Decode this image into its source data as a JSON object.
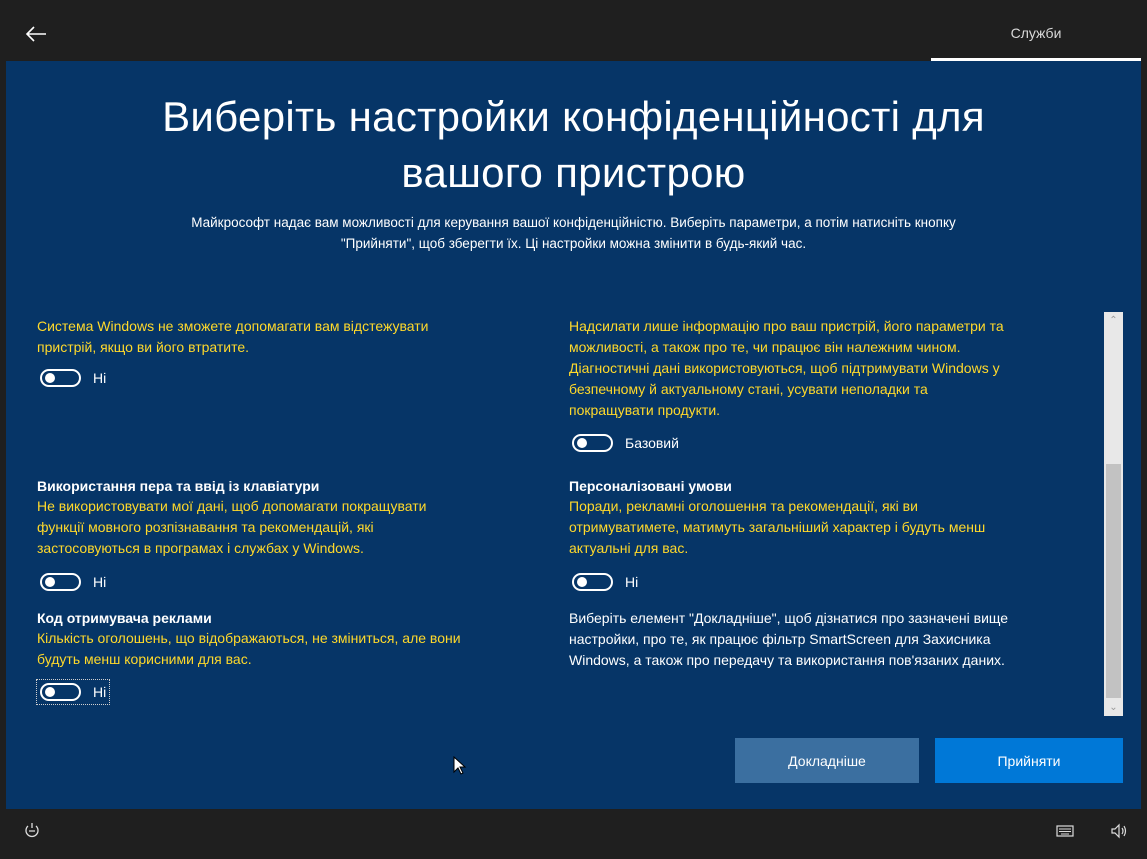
{
  "topbar": {
    "tab_label": "Служби"
  },
  "page": {
    "title_line1": "Виберіть настройки конфіденційності для",
    "title_line2": "вашого пристрою",
    "subtitle_line1": "Майкрософт надає вам можливості для керування вашої конфіденційністю. Виберіть параметри, а потім натисніть кнопку",
    "subtitle_line2": "\"Прийняти\", щоб зберегти їх. Ці настройки можна змінити в будь-який час."
  },
  "settings": {
    "find_device": {
      "desc_line1": "Система Windows не зможете допомагати вам відстежувати",
      "desc_line2": "пристрій, якщо ви його втратите.",
      "toggle_label": "Ні"
    },
    "inking": {
      "heading": "Використання пера та ввід із клавіатури",
      "desc_line1": "Не використовувати мої дані, щоб допомагати покращувати",
      "desc_line2": "функції мовного розпізнавання та рекомендацій, які",
      "desc_line3": "застосовуються в програмах і службах у Windows.",
      "toggle_label": "Ні"
    },
    "advertising_id": {
      "heading": "Код отримувача реклами",
      "desc_line1": "Кількість оголошень, що відображаються, не зміниться, але вони",
      "desc_line2": "будуть менш корисними для вас.",
      "toggle_label": "Ні"
    },
    "diagnostics": {
      "desc_line1": "Надсилати лише інформацію про ваш пристрій, його параметри та",
      "desc_line2": "можливості, а також про те, чи працює він належним чином.",
      "desc_line3": "Діагностичні дані використовуються, щоб підтримувати Windows у",
      "desc_line4": "безпечному й актуальному стані, усувати неполадки та",
      "desc_line5": "покращувати продукти.",
      "toggle_label": "Базовий"
    },
    "tailored": {
      "heading": "Персоналізовані умови",
      "desc_line1": "Поради, рекламні оголошення та рекомендації, які ви",
      "desc_line2": "отримуватимете, матимуть загальніший характер і будуть менш",
      "desc_line3": "актуальні для вас.",
      "toggle_label": "Ні"
    },
    "info": {
      "line1": "Виберіть елемент \"Докладніше\", щоб дізнатися про зазначені вище",
      "line2": "настройки, про те, як працює фільтр SmartScreen для Захисника",
      "line3": "Windows, а також про передачу та використання пов'язаних даних."
    }
  },
  "buttons": {
    "more_label": "Докладніше",
    "accept_label": "Прийняти"
  },
  "icons": {
    "back": "back-arrow-icon",
    "ease_of_access": "ease-of-access-icon",
    "keyboard": "keyboard-icon",
    "volume": "volume-icon"
  },
  "colors": {
    "background": "#063567",
    "bar": "#1f1f1f",
    "desc_text": "#ffd92b",
    "accept_button": "#0078d7",
    "more_button": "#3b6fa0"
  }
}
